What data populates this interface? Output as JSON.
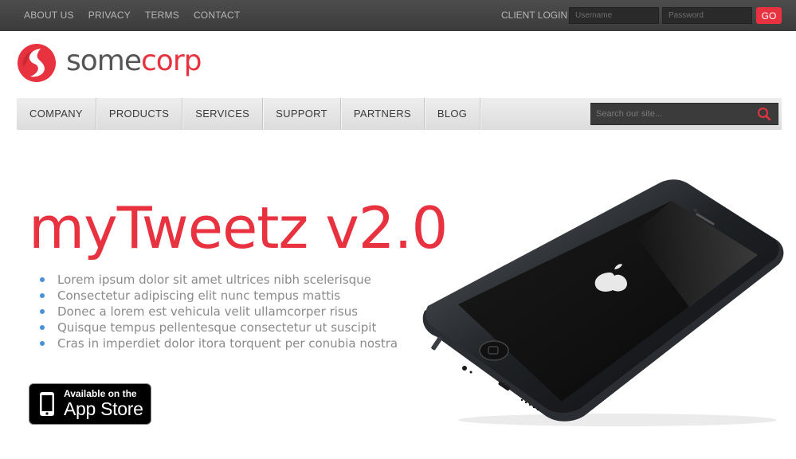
{
  "topbar": {
    "links": [
      "ABOUT US",
      "PRIVACY",
      "TERMS",
      "CONTACT"
    ],
    "client_login_label": "CLIENT LOGIN",
    "username_placeholder": "Username",
    "password_placeholder": "Password",
    "go_label": "GO"
  },
  "logo": {
    "name_part1": "some",
    "name_part2": "corp",
    "icon": "somecorp-logo-icon",
    "brand_color": "#e8323f"
  },
  "nav": {
    "items": [
      "COMPANY",
      "PRODUCTS",
      "SERVICES",
      "SUPPORT",
      "PARTNERS",
      "BLOG"
    ],
    "search_placeholder": "Search our site...",
    "search_icon": "search-icon"
  },
  "hero": {
    "title": "myTweetz v2.0",
    "features": [
      "Lorem ipsum dolor sit amet ultrices nibh scelerisque",
      "Consectetur adipiscing elit nunc tempus mattis",
      "Donec a lorem est vehicula velit ullamcorper risus",
      "Quisque tempus pellentesque consectetur ut suscipit",
      "Cras in imperdiet dolor itora torquent per conubia nostra"
    ],
    "appstore": {
      "line1": "Available on the",
      "line2": "App Store",
      "icon": "apple-icon"
    },
    "product_image": "iphone-image"
  },
  "colors": {
    "accent": "#e8323f",
    "topbar": "#444444",
    "bullet": "#4a90d9"
  }
}
